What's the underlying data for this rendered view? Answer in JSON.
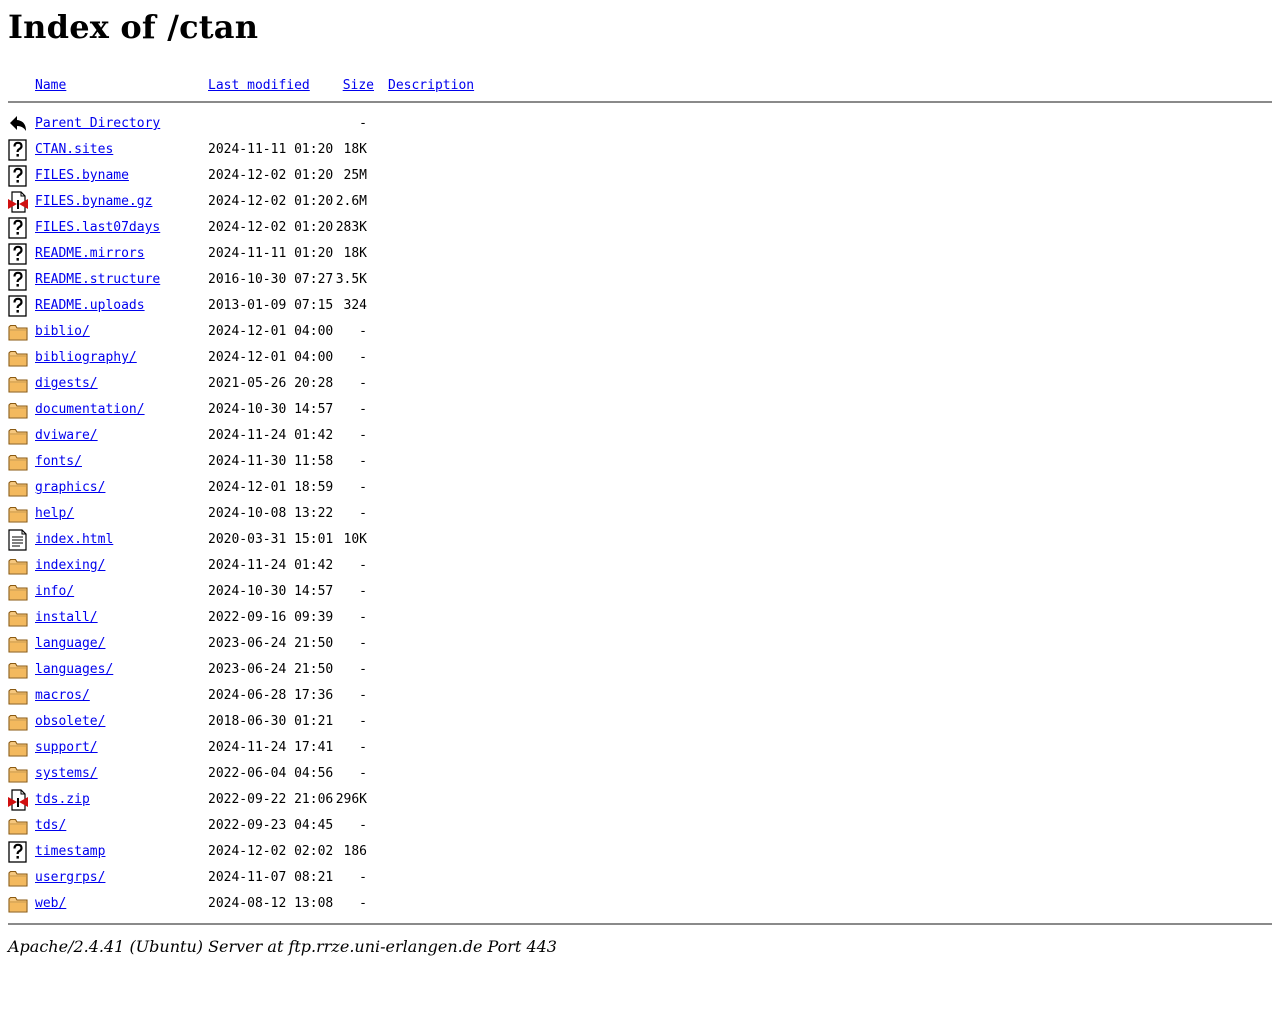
{
  "title": "Index of /ctan",
  "columns": {
    "name": "Name",
    "modified": "Last modified",
    "size": "Size",
    "description": "Description"
  },
  "entries": [
    {
      "icon": "back",
      "name": "Parent Directory",
      "modified": "",
      "size": "-"
    },
    {
      "icon": "unknown",
      "name": "CTAN.sites",
      "modified": "2024-11-11 01:20",
      "size": "18K"
    },
    {
      "icon": "unknown",
      "name": "FILES.byname",
      "modified": "2024-12-02 01:20",
      "size": "25M"
    },
    {
      "icon": "compressed",
      "name": "FILES.byname.gz",
      "modified": "2024-12-02 01:20",
      "size": "2.6M"
    },
    {
      "icon": "unknown",
      "name": "FILES.last07days",
      "modified": "2024-12-02 01:20",
      "size": "283K"
    },
    {
      "icon": "unknown",
      "name": "README.mirrors",
      "modified": "2024-11-11 01:20",
      "size": "18K"
    },
    {
      "icon": "unknown",
      "name": "README.structure",
      "modified": "2016-10-30 07:27",
      "size": "3.5K"
    },
    {
      "icon": "unknown",
      "name": "README.uploads",
      "modified": "2013-01-09 07:15",
      "size": "324"
    },
    {
      "icon": "folder",
      "name": "biblio/",
      "modified": "2024-12-01 04:00",
      "size": "-"
    },
    {
      "icon": "folder",
      "name": "bibliography/",
      "modified": "2024-12-01 04:00",
      "size": "-"
    },
    {
      "icon": "folder",
      "name": "digests/",
      "modified": "2021-05-26 20:28",
      "size": "-"
    },
    {
      "icon": "folder",
      "name": "documentation/",
      "modified": "2024-10-30 14:57",
      "size": "-"
    },
    {
      "icon": "folder",
      "name": "dviware/",
      "modified": "2024-11-24 01:42",
      "size": "-"
    },
    {
      "icon": "folder",
      "name": "fonts/",
      "modified": "2024-11-30 11:58",
      "size": "-"
    },
    {
      "icon": "folder",
      "name": "graphics/",
      "modified": "2024-12-01 18:59",
      "size": "-"
    },
    {
      "icon": "folder",
      "name": "help/",
      "modified": "2024-10-08 13:22",
      "size": "-"
    },
    {
      "icon": "text",
      "name": "index.html",
      "modified": "2020-03-31 15:01",
      "size": "10K"
    },
    {
      "icon": "folder",
      "name": "indexing/",
      "modified": "2024-11-24 01:42",
      "size": "-"
    },
    {
      "icon": "folder",
      "name": "info/",
      "modified": "2024-10-30 14:57",
      "size": "-"
    },
    {
      "icon": "folder",
      "name": "install/",
      "modified": "2022-09-16 09:39",
      "size": "-"
    },
    {
      "icon": "folder",
      "name": "language/",
      "modified": "2023-06-24 21:50",
      "size": "-"
    },
    {
      "icon": "folder",
      "name": "languages/",
      "modified": "2023-06-24 21:50",
      "size": "-"
    },
    {
      "icon": "folder",
      "name": "macros/",
      "modified": "2024-06-28 17:36",
      "size": "-"
    },
    {
      "icon": "folder",
      "name": "obsolete/",
      "modified": "2018-06-30 01:21",
      "size": "-"
    },
    {
      "icon": "folder",
      "name": "support/",
      "modified": "2024-11-24 17:41",
      "size": "-"
    },
    {
      "icon": "folder",
      "name": "systems/",
      "modified": "2022-06-04 04:56",
      "size": "-"
    },
    {
      "icon": "compressed",
      "name": "tds.zip",
      "modified": "2022-09-22 21:06",
      "size": "296K"
    },
    {
      "icon": "folder",
      "name": "tds/",
      "modified": "2022-09-23 04:45",
      "size": "-"
    },
    {
      "icon": "unknown",
      "name": "timestamp",
      "modified": "2024-12-02 02:02",
      "size": "186"
    },
    {
      "icon": "folder",
      "name": "usergrps/",
      "modified": "2024-11-07 08:21",
      "size": "-"
    },
    {
      "icon": "folder",
      "name": "web/",
      "modified": "2024-08-12 13:08",
      "size": "-"
    }
  ],
  "footer": "Apache/2.4.41 (Ubuntu) Server at ftp.rrze.uni-erlangen.de Port 443",
  "colors": {
    "link": "#0000ee",
    "folder_fill": "#f5c77e",
    "folder_stroke": "#8a5a12",
    "compressed_red": "#d01010",
    "rule": "#8a8a8a"
  }
}
